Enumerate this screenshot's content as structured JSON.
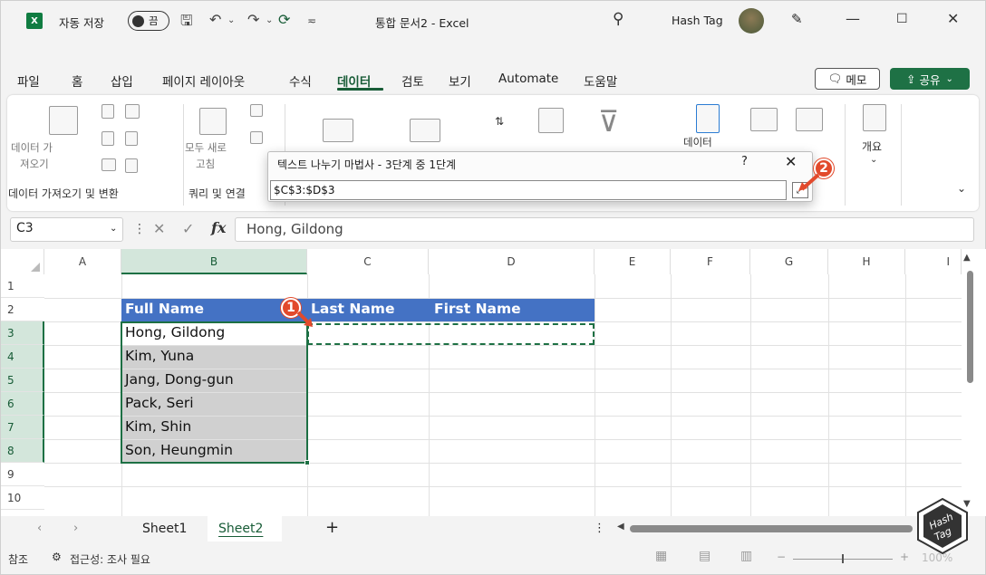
{
  "titlebar": {
    "autosave_label": "자동 저장",
    "autosave_state": "끔",
    "doc_title": "통합 문서2 - Excel",
    "user_name": "Hash Tag"
  },
  "menu": {
    "items": [
      "파일",
      "홈",
      "삽입",
      "페이지 레이아웃",
      "수식",
      "데이터",
      "검토",
      "보기",
      "Automate",
      "도움말"
    ],
    "active": "데이터",
    "memo_label": "메모",
    "share_label": "공유"
  },
  "ribbon": {
    "get_data_label": "데이터 가져오기",
    "get_data_line1": "데이터 가",
    "get_data_line2": "져오기",
    "refresh_line1": "모두 새로",
    "refresh_line2": "고침",
    "group_get_transform": "데이터 가져오기 및 변환",
    "group_queries": "쿼리 및 연결",
    "outline_label": "개요",
    "partial_label": "데이터"
  },
  "dialog": {
    "title": "텍스트 나누기 마법사 - 3단계 중 1단계",
    "help": "?",
    "close": "✕",
    "range_value": "$C$3:$D$3"
  },
  "badges": {
    "one": "1",
    "two": "2"
  },
  "formula_bar": {
    "name_box": "C3",
    "fx": "fx",
    "formula": "Hong, Gildong"
  },
  "grid": {
    "columns": [
      "A",
      "B",
      "C",
      "D",
      "E",
      "F",
      "G",
      "H",
      "I"
    ],
    "rows": [
      "1",
      "2",
      "3",
      "4",
      "5",
      "6",
      "7",
      "8",
      "9",
      "10"
    ],
    "header_row": [
      "Full Name",
      "Last Name",
      "First Name"
    ],
    "names": [
      "Hong, Gildong",
      "Kim, Yuna",
      "Jang, Dong-gun",
      "Pack, Seri",
      "Kim, Shin",
      "Son, Heungmin"
    ]
  },
  "sheets": {
    "tabs": [
      "Sheet1",
      "Sheet2"
    ],
    "active": "Sheet2",
    "add": "+"
  },
  "status": {
    "mode": "참조",
    "accessibility": "접근성: 조사 필요",
    "zoom": "100%"
  },
  "colors": {
    "excel_green": "#107c41",
    "header_blue": "#4472c4",
    "badge_red": "#e24a2c",
    "share_green": "#1e7145"
  }
}
